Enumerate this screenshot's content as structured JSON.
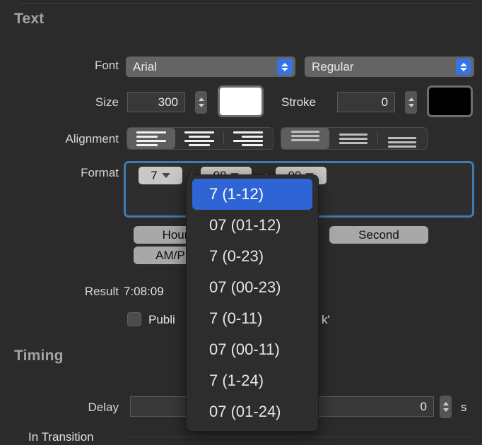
{
  "sections": {
    "text_title": "Text",
    "timing_title": "Timing"
  },
  "labels": {
    "font": "Font",
    "size": "Size",
    "stroke": "Stroke",
    "alignment": "Alignment",
    "format": "Format",
    "result": "Result",
    "delay": "Delay",
    "in_transition": "In Transition"
  },
  "font_row": {
    "family_value": "Arial",
    "style_value": "Regular"
  },
  "size_row": {
    "size_value": "300",
    "size_color": "#ffffff",
    "stroke_value": "0",
    "stroke_color": "#000000"
  },
  "alignment": {
    "horizontal": [
      "align-left",
      "align-center",
      "align-right"
    ],
    "horizontal_selected": 0,
    "vertical": [
      "align-top",
      "align-middle",
      "align-bottom"
    ],
    "vertical_selected": 0
  },
  "format_row": {
    "tokens": [
      "7",
      "08",
      "09"
    ],
    "separators": [
      ":",
      ":"
    ]
  },
  "token_buttons": {
    "hour": "Hour",
    "ampm": "AM/PM",
    "second": "Second"
  },
  "result_row": {
    "value": "7:08:09"
  },
  "publish_row": {
    "label": "Publi",
    "trailing": "k'",
    "checked": false
  },
  "timing": {
    "delay_value": "0",
    "delay_unit": "s"
  },
  "dropdown": {
    "accent": "#2f64d4",
    "selected_index": 0,
    "options": [
      "7 (1-12)",
      "07 (01-12)",
      "7 (0-23)",
      "07 (00-23)",
      "7 (0-11)",
      "07 (00-11)",
      "7 (1-24)",
      "07 (01-24)"
    ]
  }
}
